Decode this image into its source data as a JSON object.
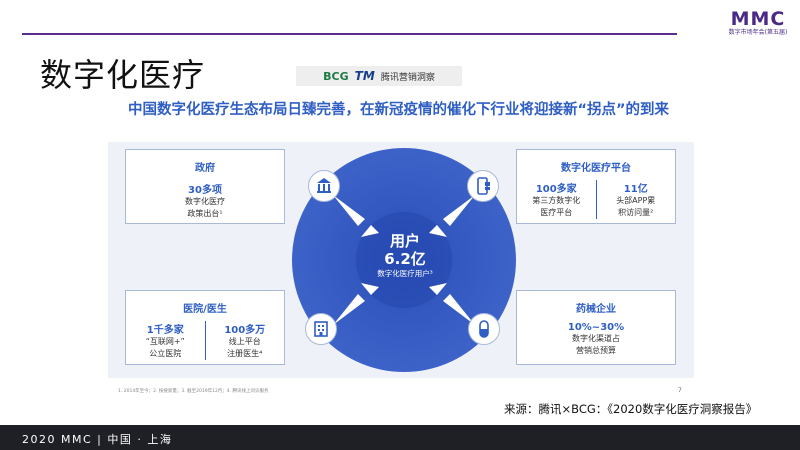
{
  "brand": {
    "logo": "MMC",
    "subtitle": "数字市场年会(第五届)"
  },
  "page_title": "数字化医疗",
  "logos": {
    "bcg": "BCG",
    "tm": "TM",
    "tm_text": "腾讯营销洞察"
  },
  "headline": "中国数字化医疗生态布局日臻完善，在新冠疫情的催化下行业将迎接新“拐点”的到来",
  "center": {
    "label": "用户",
    "value": "6.2亿",
    "desc": "数字化医疗用户³"
  },
  "government": {
    "title": "政府",
    "number": "30多项",
    "desc_line1": "数字化医疗",
    "desc_line2": "政策出台¹"
  },
  "platform": {
    "title": "数字化医疗平台",
    "left": {
      "number": "100多家",
      "line1": "第三方数字化",
      "line2": "医疗平台"
    },
    "right": {
      "number": "11亿",
      "line1": "头部APP累",
      "line2": "积访问量²"
    }
  },
  "hospital": {
    "title": "医院/医生",
    "left": {
      "number": "1千多家",
      "line1": "“互联网+”",
      "line2": "公立医院"
    },
    "right": {
      "number": "100多万",
      "line1": "线上平台",
      "line2": "注册医生⁴"
    }
  },
  "pharma": {
    "title": "药械企业",
    "number": "10%~30%",
    "desc_line1": "数字化渠道占",
    "desc_line2": "营销总预算"
  },
  "icons": [
    "government-building-icon",
    "mobile-app-icon",
    "hospital-icon",
    "pill-capsule-icon"
  ],
  "footnote": "1. 2014年至今；2. 按搜索量；3. 截至2019年12月；4. 腾讯线上问诊服务",
  "page_number": "7",
  "source": "来源：腾讯×BCG：《2020数字化医疗洞察报告》",
  "footer": "2020 MMC | 中国 · 上海",
  "colors": {
    "accent_blue": "#2f5fc4",
    "circle_blue": "#3d63c9",
    "brand_purple": "#4b2a86",
    "footer_dark": "#1f1f26"
  }
}
